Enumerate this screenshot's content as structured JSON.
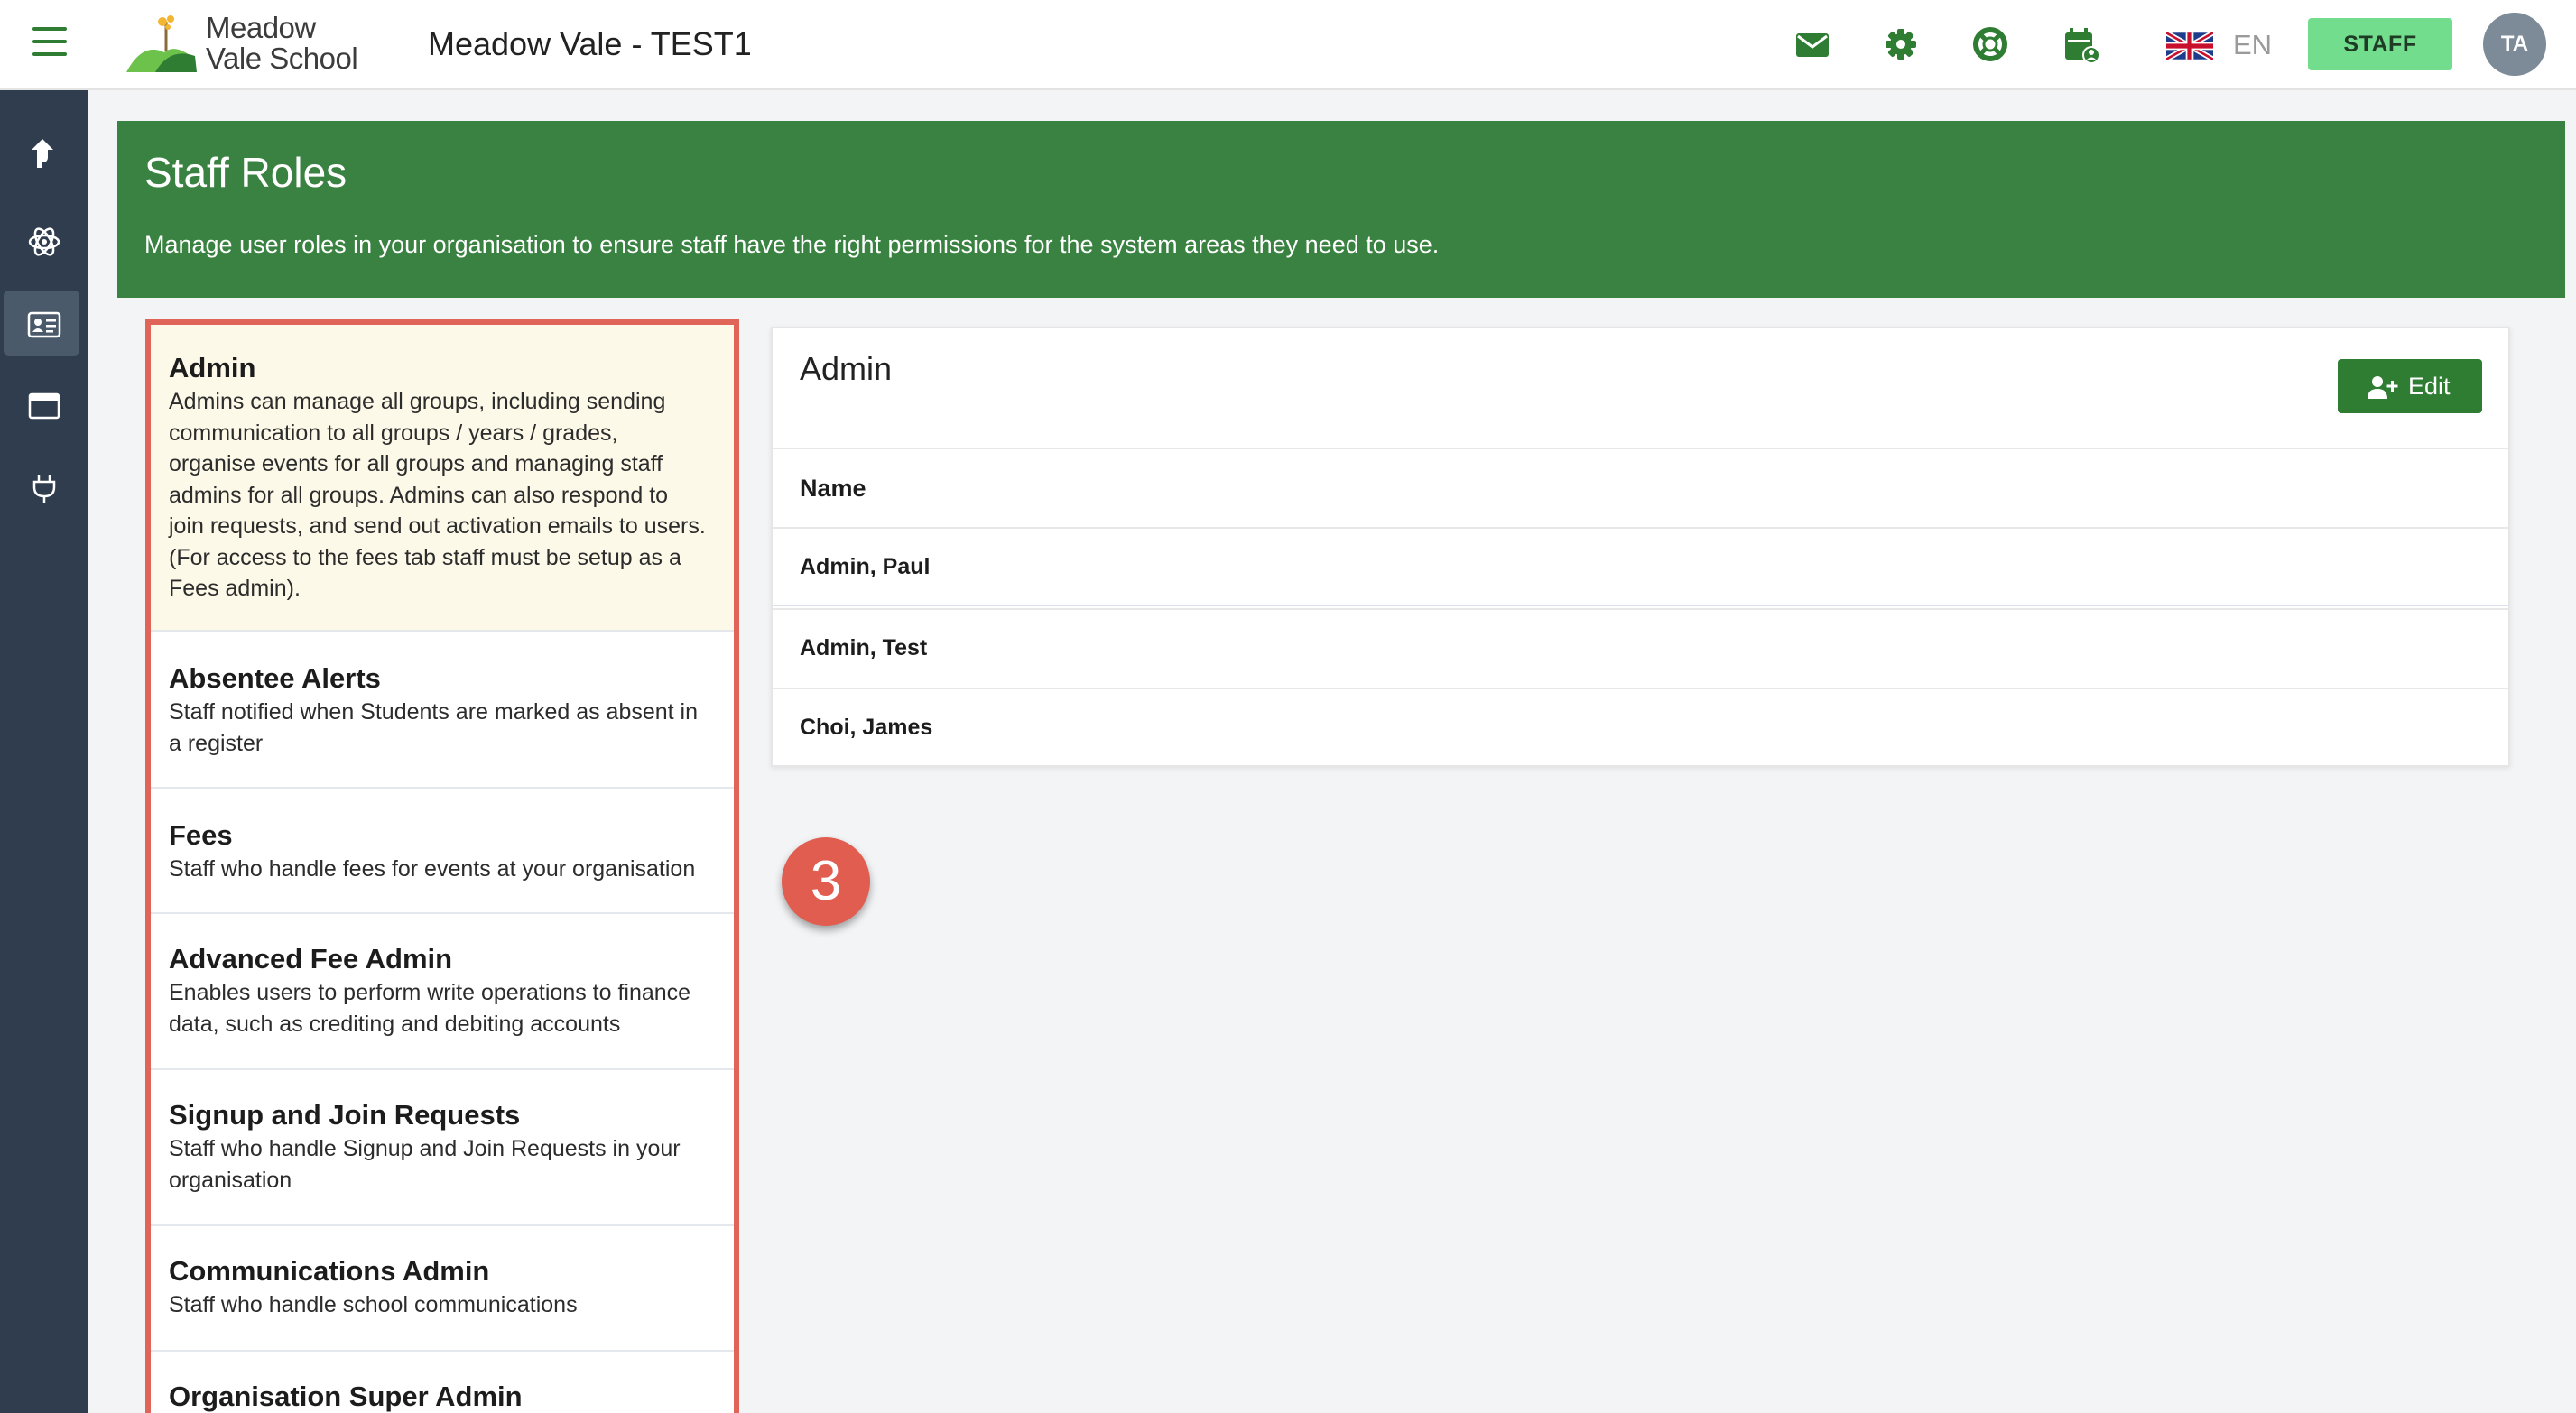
{
  "topbar": {
    "logo_line1": "Meadow",
    "logo_line2": "Vale School",
    "school_title": "Meadow Vale - TEST1",
    "icons": [
      "envelope-icon",
      "gear-icon",
      "lifebuoy-icon",
      "calendar-user-icon"
    ],
    "language": "EN",
    "language_flag": "uk-flag-icon",
    "staff_label": "STAFF",
    "avatar_initials": "TA"
  },
  "leftnav": {
    "items": [
      "share-arrow-icon",
      "atom-icon",
      "id-card-icon",
      "window-icon",
      "plug-icon"
    ],
    "active_index": 2
  },
  "header": {
    "title": "Staff Roles",
    "description": "Manage user roles in your organisation to ensure staff have the right permissions for the system areas they need to use."
  },
  "roles": [
    {
      "name": "Admin",
      "description_lines": [
        "Admins can manage all groups, including sending",
        "communication to all groups / years / grades,",
        "organise events for all groups and managing staff",
        "admins for all groups. Admins can also respond to",
        "join requests, and send out activation emails to users.",
        "(For access to the fees tab staff must be setup as a",
        "Fees admin)."
      ],
      "selected": true
    },
    {
      "name": "Absentee Alerts",
      "description_lines": [
        "Staff notified when Students are marked as absent in",
        "a register"
      ],
      "selected": false
    },
    {
      "name": "Fees",
      "description_lines": [
        "Staff who handle fees for events at your organisation"
      ],
      "selected": false
    },
    {
      "name": "Advanced Fee Admin",
      "description_lines": [
        "Enables users to perform write operations to finance",
        "data, such as crediting and debiting accounts"
      ],
      "selected": false
    },
    {
      "name": "Signup and Join Requests",
      "description_lines": [
        "Staff who handle Signup and Join Requests in your",
        "organisation"
      ],
      "selected": false
    },
    {
      "name": "Communications Admin",
      "description_lines": [
        "Staff who handle school communications"
      ],
      "selected": false
    },
    {
      "name": "Organisation Super Admin",
      "description_lines": [],
      "selected": false
    }
  ],
  "detail": {
    "title": "Admin",
    "edit_label": "Edit",
    "column_header": "Name",
    "members": [
      "Admin, Paul",
      "Admin, Test",
      "Choi, James"
    ]
  },
  "step_badge": "3",
  "colors": {
    "brand_green": "#3a8241",
    "button_green": "#2e7d32",
    "staff_green": "#72dd8c",
    "nav_dark": "#2f3d4e",
    "highlight_red": "#e06458",
    "selected_row_bg": "#fdf9e8"
  }
}
